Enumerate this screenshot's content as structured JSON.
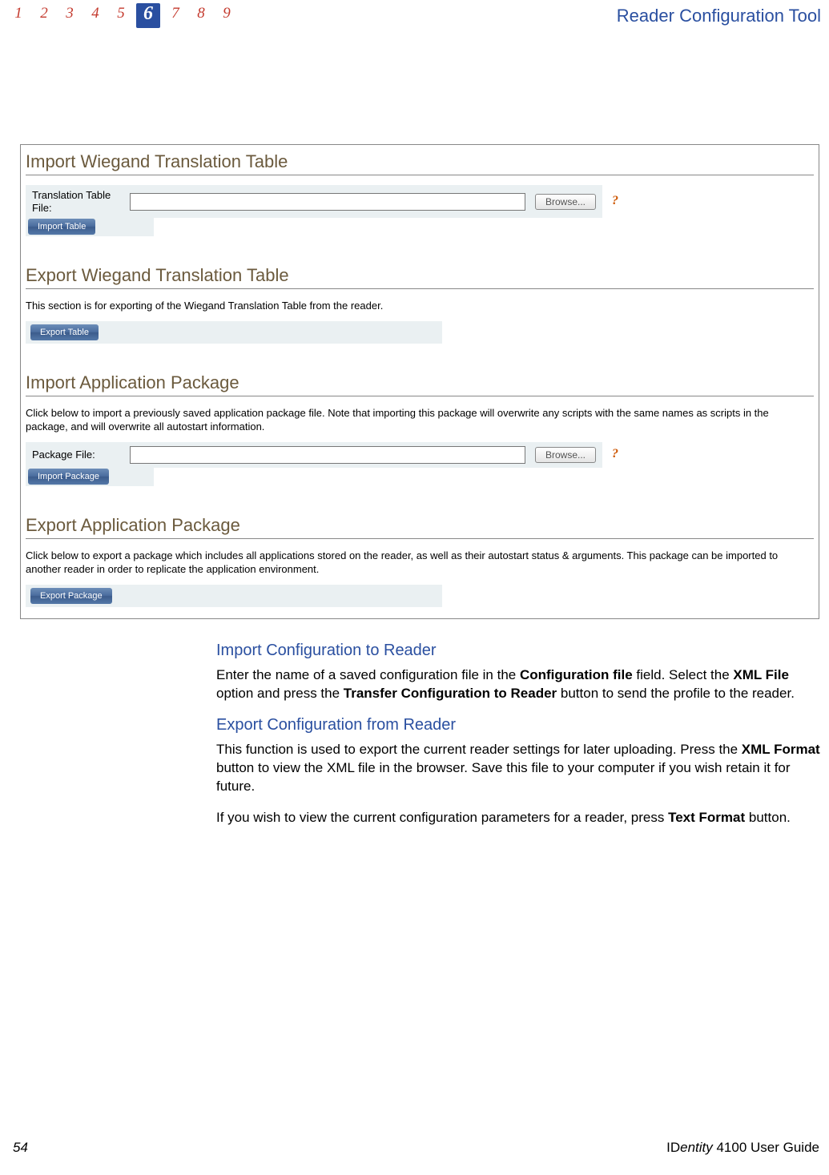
{
  "header": {
    "tabs": [
      "1",
      "2",
      "3",
      "4",
      "5",
      "6",
      "7",
      "8",
      "9"
    ],
    "active": "6",
    "title": "Reader Configuration Tool"
  },
  "screenshot": {
    "s1": {
      "title": "Import Wiegand Translation Table",
      "label": "Translation Table File:",
      "browse": "Browse...",
      "help": "?",
      "button": "Import Table"
    },
    "s2": {
      "title": "Export Wiegand Translation Table",
      "desc": "This section is for exporting of the Wiegand Translation Table from the reader.",
      "button": "Export Table"
    },
    "s3": {
      "title": "Import Application Package",
      "desc": "Click below to import a previously saved application package file. Note that importing this package will overwrite any scripts with the same names as scripts in the package, and will overwrite all autostart information.",
      "label": "Package File:",
      "browse": "Browse...",
      "help": "?",
      "button": "Import Package"
    },
    "s4": {
      "title": "Export Application Package",
      "desc": "Click below to export a package which includes all applications stored on the reader, as well as their autostart status & arguments. This package can be imported to another reader in order to replicate the application environment.",
      "button": "Export Package"
    }
  },
  "doc": {
    "h1": "Import Configuration to Reader",
    "p1a": "Enter the name of a saved configuration file in the ",
    "p1b": "Configuration file",
    "p1c": " field. Select the ",
    "p1d": "XML File",
    "p1e": " option and press the ",
    "p1f": "Transfer Configuration to Reader",
    "p1g": " button to send the profile to the reader.",
    "h2": "Export Configuration from Reader",
    "p2a": "This function is used to export the current reader settings for later uploading. Press the ",
    "p2b": "XML Format",
    "p2c": " button to view the XML file in the browser. Save this file to your computer if you wish retain it for future.",
    "p3a": "If you wish to view the current configuration parameters for a reader, press ",
    "p3b": "Text Format",
    "p3c": " button."
  },
  "footer": {
    "page": "54",
    "guide_pre": "ID",
    "guide_em": "entity",
    "guide_post": " 4100 User Guide"
  }
}
